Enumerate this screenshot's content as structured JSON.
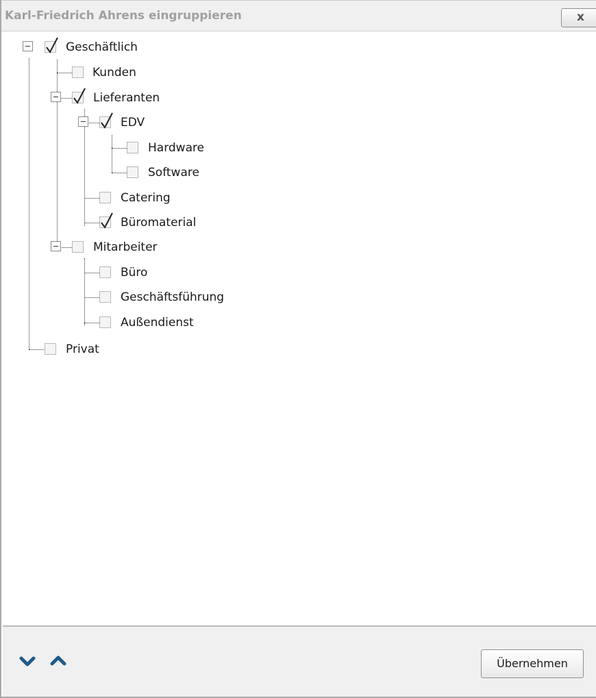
{
  "window": {
    "title": "Karl-Friedrich Ahrens eingruppieren",
    "close_label": "x"
  },
  "tree": {
    "nodes": [
      {
        "label": "Geschäftlich",
        "checked": true,
        "expanded": true
      },
      {
        "label": "Kunden",
        "checked": false
      },
      {
        "label": "Lieferanten",
        "checked": true,
        "expanded": true
      },
      {
        "label": "EDV",
        "checked": true,
        "expanded": true
      },
      {
        "label": "Hardware",
        "checked": false
      },
      {
        "label": "Software",
        "checked": false
      },
      {
        "label": "Catering",
        "checked": false
      },
      {
        "label": "Büromaterial",
        "checked": true
      },
      {
        "label": "Mitarbeiter",
        "checked": false,
        "expanded": true
      },
      {
        "label": "Büro",
        "checked": false
      },
      {
        "label": "Geschäftsführung",
        "checked": false
      },
      {
        "label": "Außendienst",
        "checked": false
      },
      {
        "label": "Privat",
        "checked": false
      }
    ]
  },
  "footer": {
    "move_down_icon": "chevron-down-icon",
    "move_up_icon": "chevron-up-icon",
    "apply_label": "Übernehmen"
  },
  "colors": {
    "accent": "#1e5a8a",
    "title_text": "#a0a0a0"
  }
}
